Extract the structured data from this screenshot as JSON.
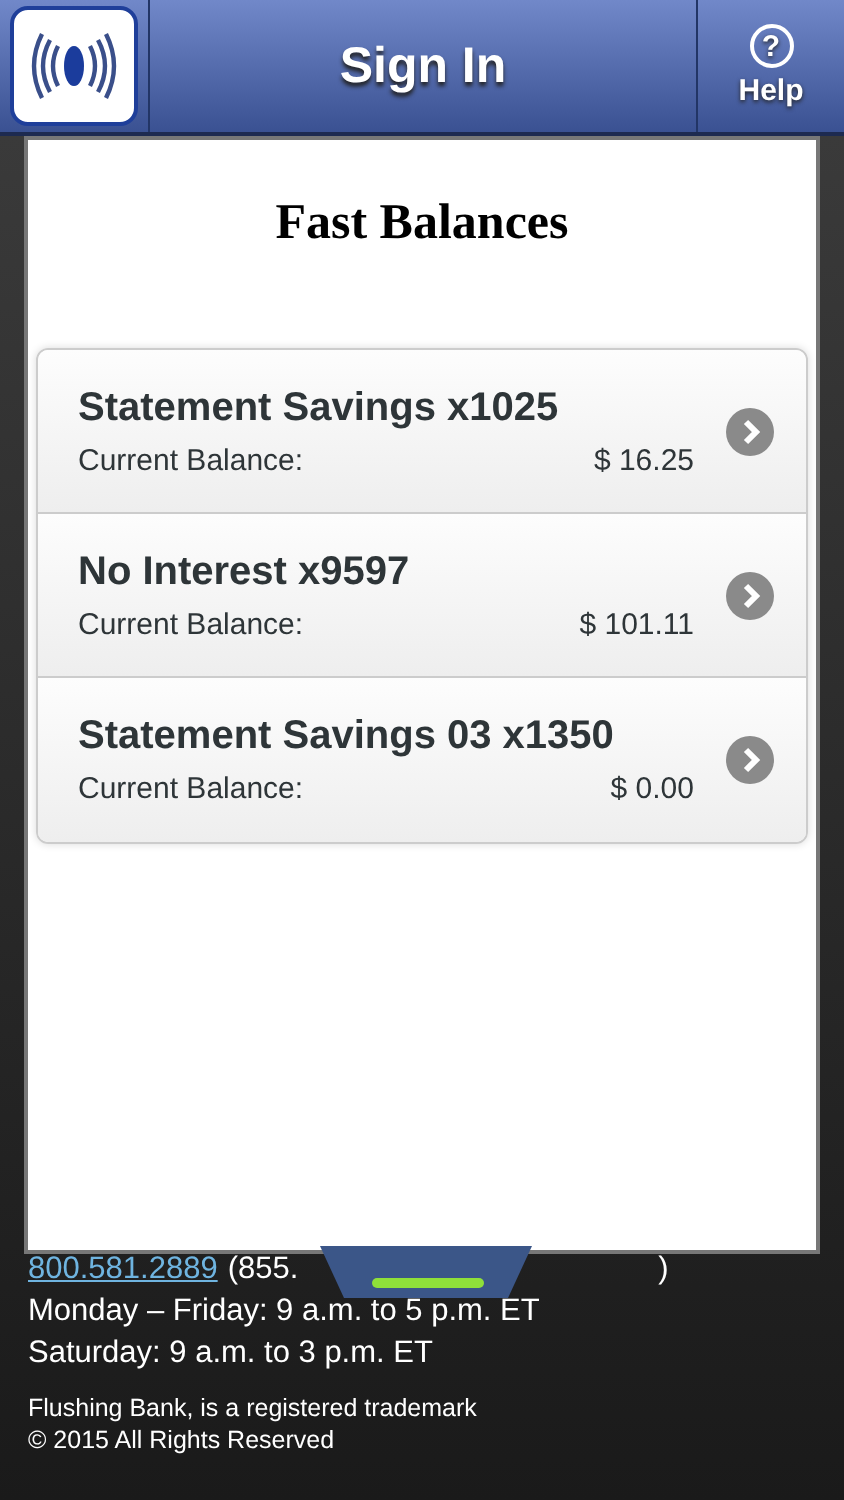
{
  "header": {
    "title": "Sign In",
    "help_label": "Help",
    "help_glyph": "?"
  },
  "panel": {
    "title": "Fast Balances",
    "accounts": [
      {
        "name": "Statement Savings x1025",
        "balance_label": "Current Balance:",
        "balance": "$ 16.25"
      },
      {
        "name": "No Interest x9597",
        "balance_label": "Current Balance:",
        "balance": "$ 101.11"
      },
      {
        "name": "Statement Savings 03 x1350",
        "balance_label": "Current Balance:",
        "balance": "$ 0.00"
      }
    ]
  },
  "footer": {
    "phone": "800.581.2889",
    "phone_alt_start": "(855.",
    "phone_alt_end": ")",
    "hours": [
      "Monday – Friday: 9 a.m. to 5 p.m. ET",
      "Saturday: 9 a.m. to 3 p.m. ET"
    ],
    "legal": [
      "Flushing Bank, is a registered trademark",
      "© 2015 All Rights Reserved"
    ]
  }
}
